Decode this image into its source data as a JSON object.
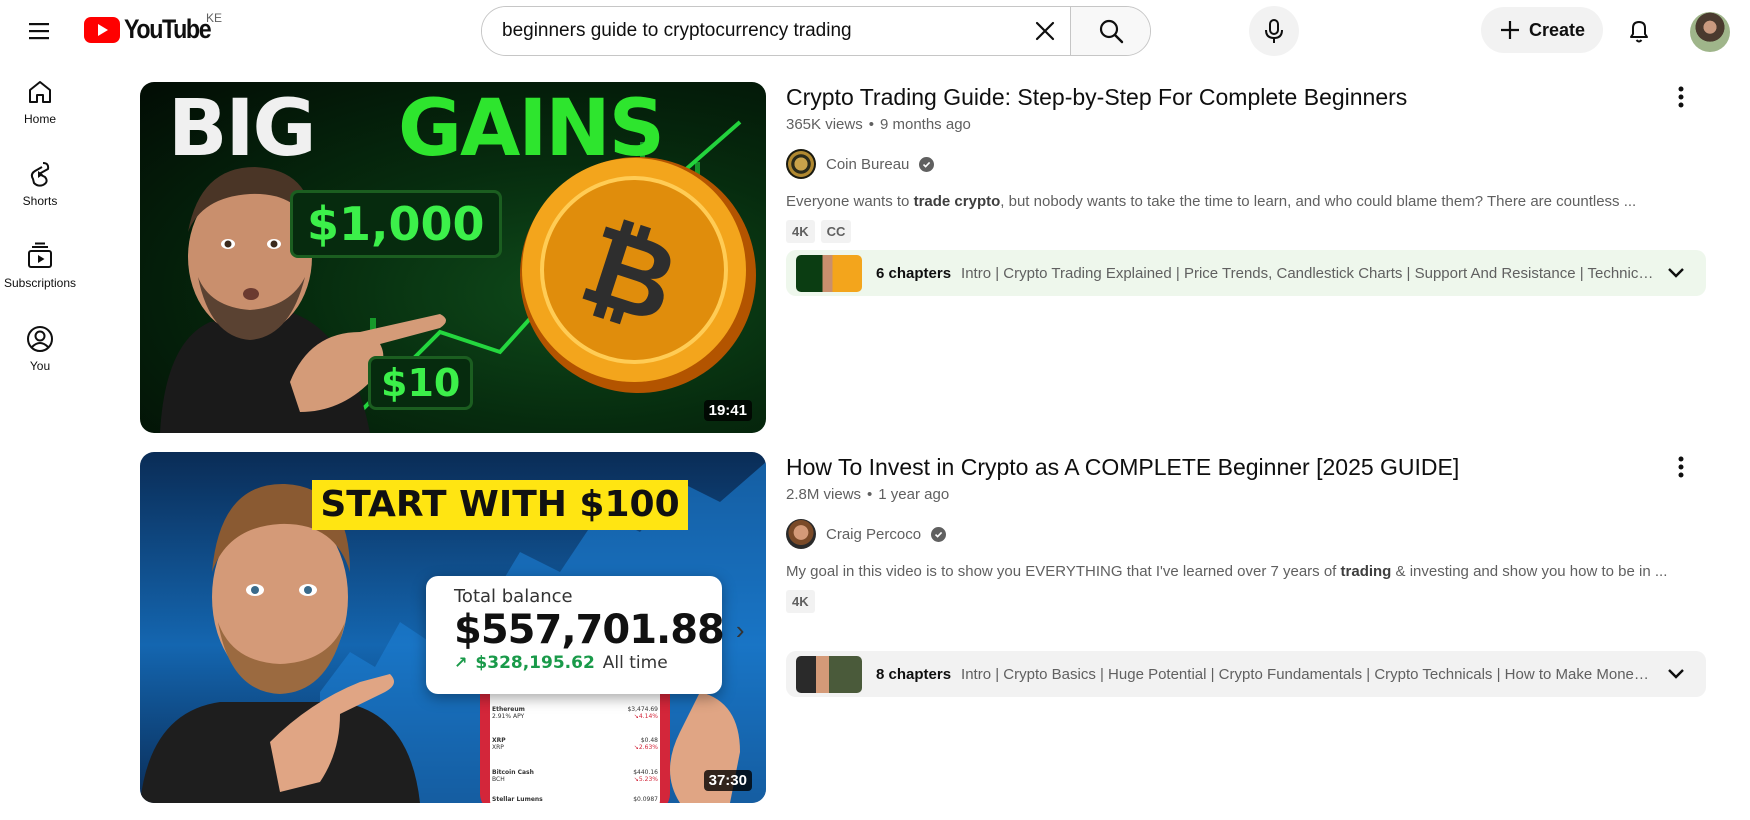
{
  "header": {
    "logo_text": "YouTube",
    "country_code": "KE",
    "search_value": "beginners guide to cryptocurrency trading",
    "create_label": "Create"
  },
  "sidebar": {
    "items": [
      {
        "label": "Home",
        "icon": "home-icon"
      },
      {
        "label": "Shorts",
        "icon": "shorts-icon"
      },
      {
        "label": "Subscriptions",
        "icon": "subscriptions-icon"
      },
      {
        "label": "You",
        "icon": "user-icon"
      }
    ]
  },
  "results": [
    {
      "title": "Crypto Trading Guide: Step-by-Step For Complete Beginners",
      "views": "365K views",
      "age": "9 months ago",
      "channel": "Coin Bureau",
      "description_pre": "Everyone wants to ",
      "description_bold": "trade crypto",
      "description_post": ", but nobody wants to take the time to learn, and who could blame them? There are countless ...",
      "badges": [
        "4K",
        "CC"
      ],
      "duration": "19:41",
      "chapters_count": "6 chapters",
      "chapters_text": "Intro | Crypto Trading Explained | Price Trends, Candlestick Charts | Support And Resistance | Technical...",
      "thumb_text": {
        "big": "BIG",
        "gains": "GAINS",
        "amount_high": "$1,000",
        "amount_low": "$10"
      }
    },
    {
      "title": "How To Invest in Crypto as A COMPLETE Beginner [2025 GUIDE]",
      "views": "2.8M views",
      "age": "1 year ago",
      "channel": "Craig Percoco",
      "description_pre": "My goal in this video is to show you EVERYTHING that I've learned over 7 years of ",
      "description_bold": "trading",
      "description_post": " & investing and show you how to be in ...",
      "badges": [
        "4K"
      ],
      "duration": "37:30",
      "chapters_count": "8 chapters",
      "chapters_text": "Intro | Crypto Basics | Huge Potential | Crypto Fundamentals | Crypto Technicals | How to Make Money |...",
      "thumb_text": {
        "banner": "START WITH $100",
        "balance_label": "Total balance",
        "balance": "$557,701.88",
        "gain": "$328,195.62",
        "gain_period": "All time",
        "coins": [
          {
            "name": "Ethereum",
            "sub": "2.91% APY",
            "price": "$3,474.69",
            "change": "↘4.14%"
          },
          {
            "name": "XRP",
            "sub": "XRP",
            "price": "$0.48",
            "change": "↘2.63%"
          },
          {
            "name": "Bitcoin Cash",
            "sub": "BCH",
            "price": "$440.16",
            "change": "↘5.23%"
          },
          {
            "name": "Stellar Lumens",
            "sub": "",
            "price": "$0.0987",
            "change": ""
          }
        ]
      }
    }
  ],
  "colors": {
    "brand_red": "#ff0000",
    "verified_gray": "#606060",
    "chapters_green_bg": "#eef7ec",
    "thumb_green": "#22e03c",
    "banner_yellow": "#ffe512"
  }
}
